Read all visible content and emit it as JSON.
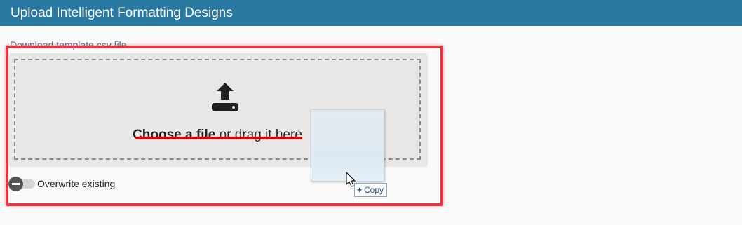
{
  "header": {
    "title": "Upload Intelligent Formatting Designs"
  },
  "download_link": {
    "label": "Download template csv file"
  },
  "dropzone": {
    "choose_label": "Choose a file",
    "rest_label": "or drag it here",
    "icon": "upload-icon"
  },
  "overwrite": {
    "label": "Overwrite existing",
    "checked": false
  },
  "drag_feedback": {
    "copy_label": "Copy",
    "plus": "+"
  },
  "colors": {
    "header_bg": "#2979a3",
    "annotation_red": "#e0383e",
    "underline_red": "#e00000",
    "link": "#3b6ea5"
  }
}
